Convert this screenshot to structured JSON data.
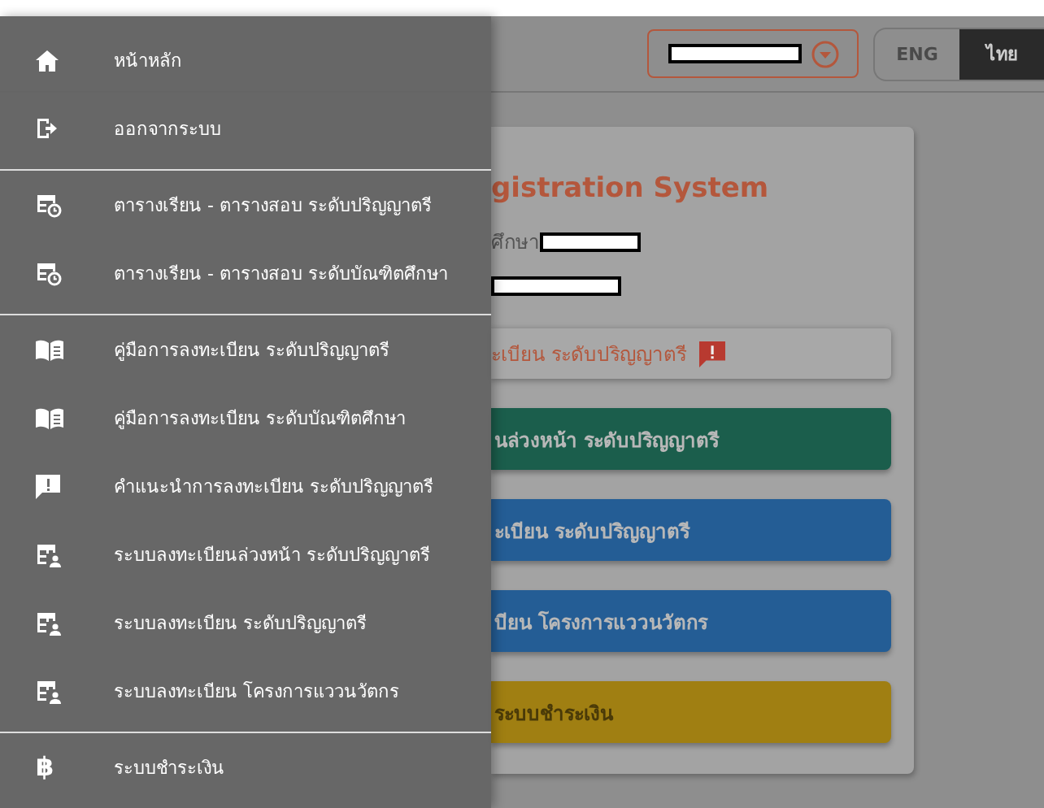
{
  "drawer": {
    "groups": [
      {
        "items": [
          {
            "kind": "home",
            "label": "หน้าหลัก"
          },
          {
            "kind": "logout",
            "label": "ออกจากระบบ"
          }
        ]
      },
      {
        "items": [
          {
            "kind": "schedule",
            "label": "ตารางเรียน - ตารางสอบ ระดับปริญญาตรี"
          },
          {
            "kind": "schedule",
            "label": "ตารางเรียน - ตารางสอบ ระดับบัณฑิตศึกษา"
          }
        ]
      },
      {
        "items": [
          {
            "kind": "manual",
            "label": "คู่มือการลงทะเบียน ระดับปริญญาตรี"
          },
          {
            "kind": "manual",
            "label": "คู่มือการลงทะเบียน ระดับบัณฑิตศึกษา"
          },
          {
            "kind": "advice",
            "label": "คำแนะนำการลงทะเบียน ระดับปริญญาตรี"
          },
          {
            "kind": "register",
            "label": "ระบบลงทะเบียนล่วงหน้า ระดับปริญญาตรี"
          },
          {
            "kind": "register",
            "label": "ระบบลงทะเบียน ระดับปริญญาตรี"
          },
          {
            "kind": "register",
            "label": "ระบบลงทะเบียน โครงการแววนวัตกร"
          }
        ]
      },
      {
        "items": [
          {
            "kind": "payment",
            "icon": "฿",
            "label": "ระบบชำระเงิน"
          }
        ]
      }
    ]
  },
  "header": {
    "languages": [
      {
        "label": "ENG",
        "selected": false
      },
      {
        "label": "ไทย",
        "selected": true
      }
    ]
  },
  "card": {
    "title": "gistration System",
    "student_label": "ศึกษา",
    "alert": {
      "label": "ะเบียน ระดับปริญญาตรี"
    },
    "buttons": [
      {
        "label": "นล่วงหน้า ระดับปริญญาตรี",
        "color": "#1b5e4c"
      },
      {
        "label": "ะเบียน ระดับปริญญาตรี",
        "color": "#245d95"
      },
      {
        "label": "บียน โครงการแววนวัตกร",
        "color": "#245d95"
      },
      {
        "label": "ระบบชำระเงิน",
        "color": "#a07f12"
      }
    ]
  }
}
